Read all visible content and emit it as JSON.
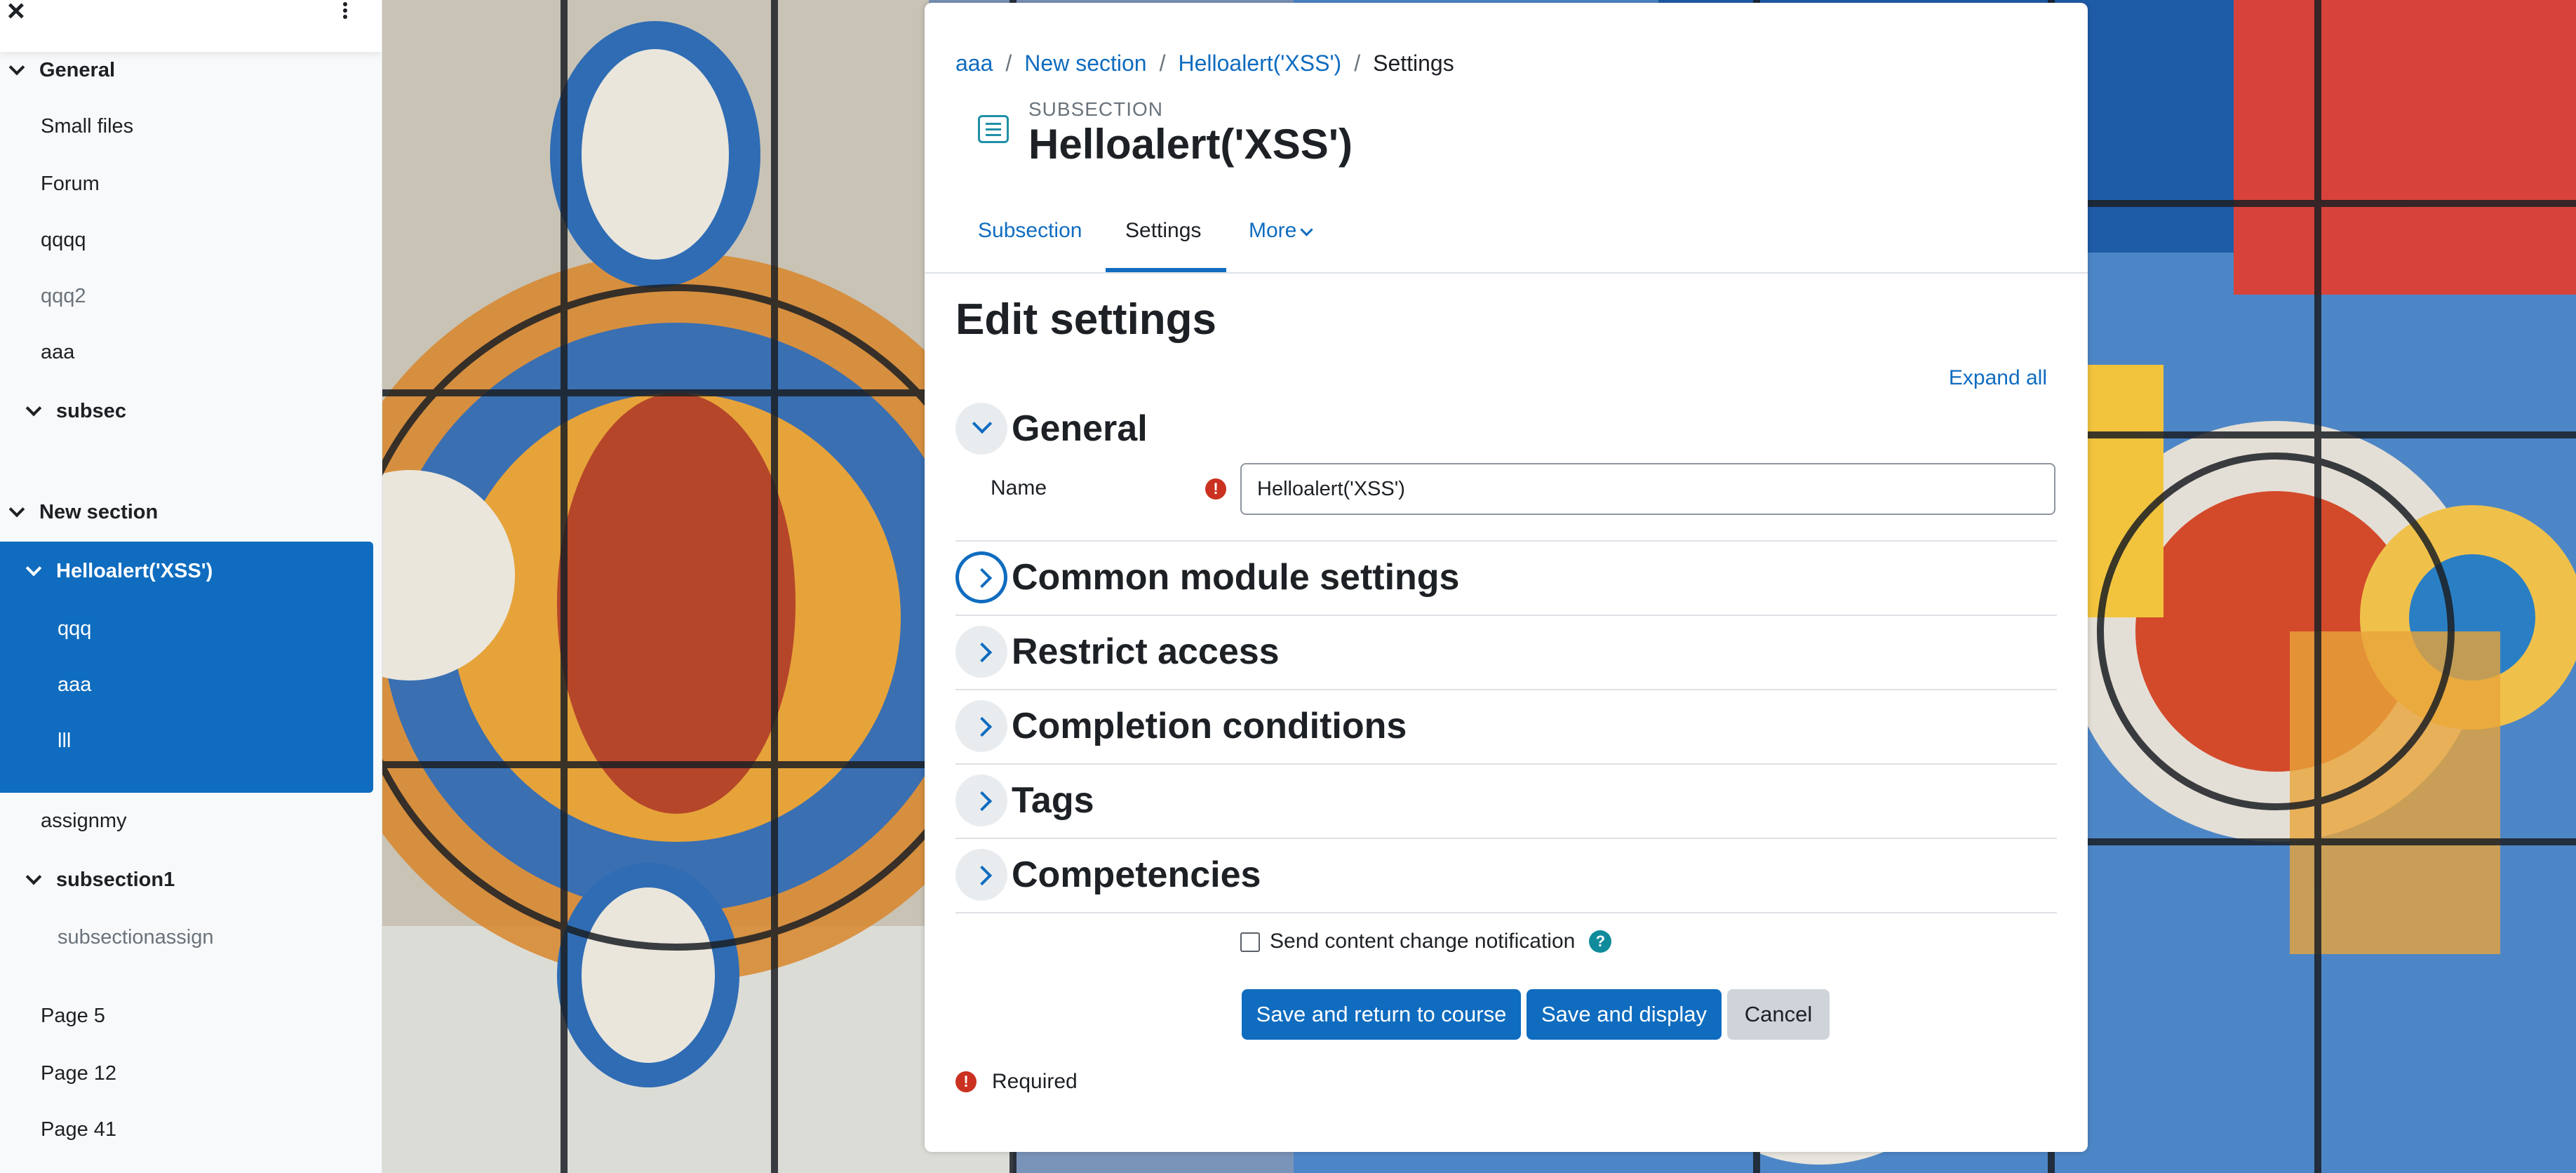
{
  "drawer": {
    "close_glyph": "×",
    "items": [
      {
        "label": "General",
        "bold": true,
        "chevron": true
      },
      {
        "label": "Small files"
      },
      {
        "label": "Forum"
      },
      {
        "label": "qqqq"
      },
      {
        "label": "qqq2",
        "dim": true
      },
      {
        "label": "aaa"
      },
      {
        "label": "subsec",
        "bold": true,
        "chevron": true
      },
      {
        "label": "New section",
        "bold": true,
        "chevron": true
      },
      {
        "label": "Helloalert('XSS')",
        "bold": true,
        "chevron": true,
        "active": true
      },
      {
        "label": "qqq",
        "active": true
      },
      {
        "label": "aaa",
        "active": true
      },
      {
        "label": "lll",
        "active": true
      },
      {
        "label": "assignmy"
      },
      {
        "label": "subsection1",
        "bold": true,
        "chevron": true
      },
      {
        "label": "subsectionassign",
        "dim": true
      },
      {
        "label": "Page 5"
      },
      {
        "label": "Page 12"
      },
      {
        "label": "Page 41"
      }
    ]
  },
  "breadcrumb": {
    "items": [
      "aaa",
      "New section",
      "Helloalert('XSS')"
    ],
    "current": "Settings",
    "separator": "/"
  },
  "header": {
    "kicker": "SUBSECTION",
    "title": "Helloalert('XSS')",
    "icon": "subsection-icon"
  },
  "tabs": {
    "subsection": "Subsection",
    "settings": "Settings",
    "more": "More"
  },
  "form": {
    "heading": "Edit settings",
    "expand_all": "Expand all",
    "general_title": "General",
    "name_label": "Name",
    "name_value": "Helloalert('XSS')",
    "required_icon": "!",
    "sections": [
      "Common module settings",
      "Restrict access",
      "Completion conditions",
      "Tags",
      "Competencies"
    ],
    "notify_label": "Send content change notification",
    "help_glyph": "?",
    "save_return": "Save and return to course",
    "save_display": "Save and display",
    "cancel": "Cancel",
    "required_text": "Required"
  },
  "colors": {
    "primary": "#0f6cbf",
    "error": "#ca3120",
    "help": "#0f8b9b"
  }
}
